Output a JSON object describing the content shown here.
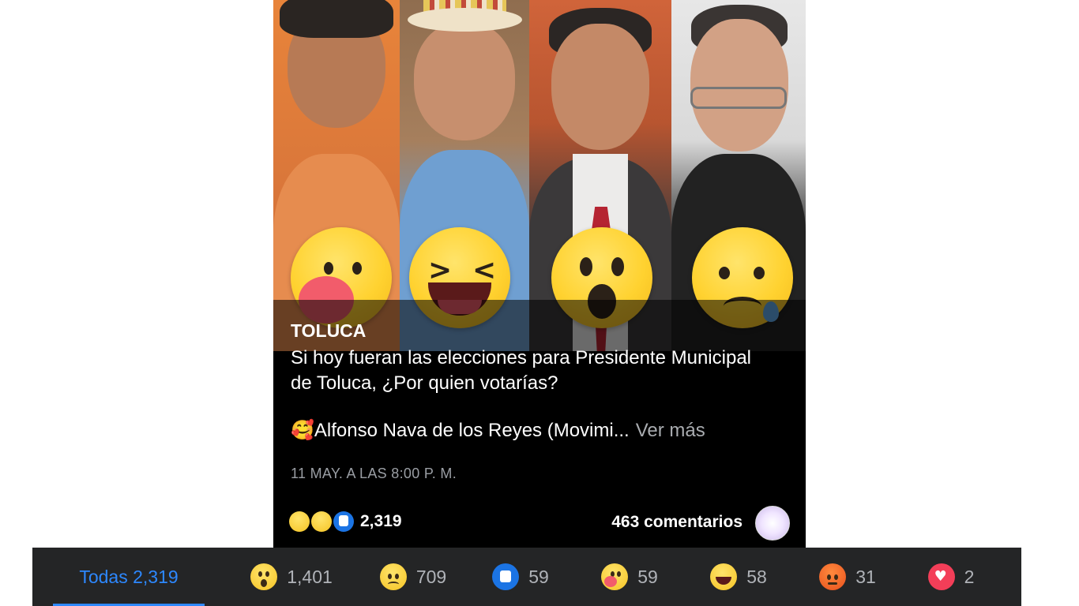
{
  "post": {
    "title": "TOLUCA",
    "caption": "Si hoy fueran las elecciones para Presidente Municipal de Toluca, ¿Por quien votarías?",
    "caption_second_emoji": "🥰",
    "caption_second": "Alfonso Nava de los Reyes (Movimi...",
    "see_more": "Ver más",
    "timestamp": "11 MAY. A LAS 8:00 P. M.",
    "reaction_icons": [
      "wow-icon",
      "sad-icon",
      "like-icon"
    ],
    "reaction_total": "2,319",
    "comments": "463 comentarios",
    "big_emojis": [
      "care-icon",
      "haha-icon",
      "wow-icon",
      "sad-icon"
    ]
  },
  "tabs": [
    {
      "label": "Todas 2,319",
      "icon": null,
      "active": true
    },
    {
      "icon": "wow-icon",
      "count": "1,401"
    },
    {
      "icon": "sad-icon",
      "count": "709"
    },
    {
      "icon": "like-icon",
      "count": "59"
    },
    {
      "icon": "care-icon",
      "count": "59"
    },
    {
      "icon": "haha-icon",
      "count": "58"
    },
    {
      "icon": "angry-icon",
      "count": "31"
    },
    {
      "icon": "love-icon",
      "count": "2"
    }
  ],
  "colors": {
    "tab_bar_bg": "#242526",
    "active_tab": "#2d88ff",
    "reaction_yellow": "#ffd230",
    "like_blue": "#1b74e4"
  }
}
